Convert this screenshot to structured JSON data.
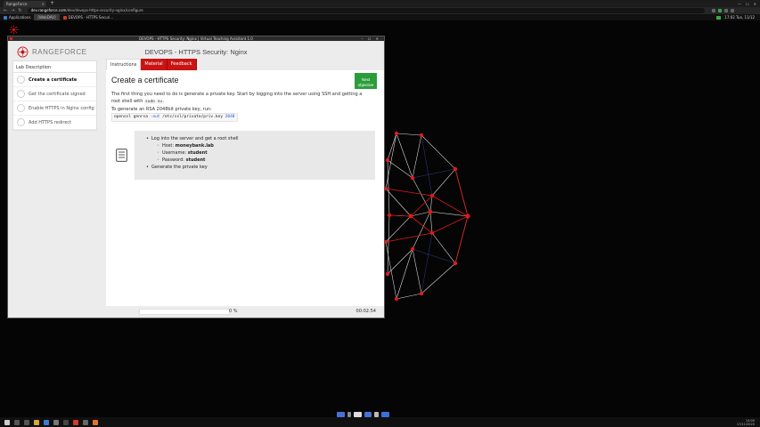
{
  "host_browser": {
    "tab_title": "RangeForce",
    "url_host": "dev.rangeforce.com",
    "url_path": "/dev/devops-https-security-nginx/configure"
  },
  "remote_desktop": {
    "apps": [
      {
        "label": "Applications",
        "color": "#3b7bd6",
        "selected": false
      },
      {
        "label": "[WebDAV]",
        "color": "#777777",
        "selected": true
      },
      {
        "label": "DEVOPS - HTTPS Securi...",
        "color": "#d23a2a",
        "selected": false
      }
    ],
    "clock": "17:02 Tue, 11/12"
  },
  "app": {
    "window_title": "DEVOPS - HTTPS Security: Nginx | Virtual Teaching Assistant 1.0",
    "brand": "RANGEFORCE",
    "lab_title": "DEVOPS - HTTPS Security: Nginx",
    "sidebar": {
      "title": "Lab Description",
      "steps": [
        {
          "label": "Create a certificate",
          "active": true
        },
        {
          "label": "Get the certificate signed",
          "active": false
        },
        {
          "label": "Enable HTTPS in Nginx config",
          "active": false
        },
        {
          "label": "Add HTTPS redirect",
          "active": false
        }
      ]
    },
    "tabs": [
      {
        "label": "Instructions",
        "active": true
      },
      {
        "label": "Material",
        "active": false
      },
      {
        "label": "Feedback",
        "active": false
      }
    ],
    "content": {
      "heading": "Create a certificate",
      "next_button": {
        "line1": "Next",
        "line2": "objective"
      },
      "intro_text": "The first thing you need to do is generate a private key. Start by logging into the server using SSH and getting a root shell with",
      "intro_code": "sudo su",
      "intro_end": ".",
      "rsa_text": "To generate an RSA 2048bit private key, run:",
      "command": {
        "cmd": "openssl genrsa",
        "flag": "-out",
        "path": "/etc/ssl/private/priv.key",
        "bits": "2048"
      },
      "info": {
        "item1": "Log into the server and get a root shell",
        "host_label": "Host:",
        "host_value": "moneybank.lab",
        "user_label": "Username:",
        "user_value": "student",
        "pass_label": "Password:",
        "pass_value": "student",
        "item2": "Generate the private key"
      }
    },
    "footer": {
      "progress_percent": 0,
      "progress_text": "0 %",
      "timer": "00:02:54"
    }
  },
  "host_taskbar": {
    "clock_time": "14:05",
    "clock_date": "17/11/2020"
  },
  "colors": {
    "accent_red": "#c91414",
    "next_green": "#2a9d3a"
  }
}
